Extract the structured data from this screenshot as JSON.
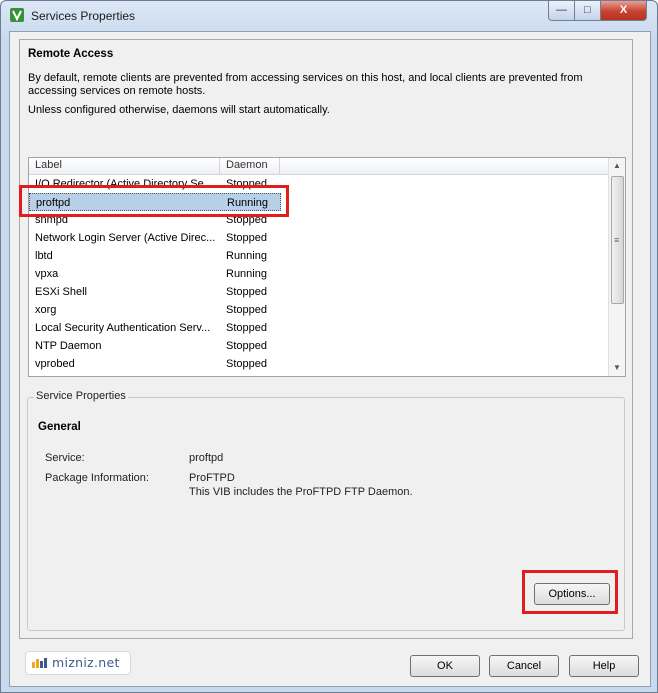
{
  "window": {
    "title": "Services Properties",
    "minimize_glyph": "—",
    "maximize_glyph": "□",
    "close_glyph": "X"
  },
  "header": {
    "title": "Remote Access",
    "description1": "By default, remote clients are prevented from accessing services on this host, and local clients are prevented from accessing services on remote hosts.",
    "description2": "Unless configured otherwise, daemons will start automatically."
  },
  "list": {
    "columns": [
      "Label",
      "Daemon"
    ],
    "rows": [
      {
        "label": "I/O Redirector (Active Directory Se...",
        "daemon": "Stopped"
      },
      {
        "label": "proftpd",
        "daemon": "Running"
      },
      {
        "label": "snmpd",
        "daemon": "Stopped"
      },
      {
        "label": "Network Login Server (Active Direc...",
        "daemon": "Stopped"
      },
      {
        "label": "lbtd",
        "daemon": "Running"
      },
      {
        "label": "vpxa",
        "daemon": "Running"
      },
      {
        "label": "ESXi Shell",
        "daemon": "Stopped"
      },
      {
        "label": "xorg",
        "daemon": "Stopped"
      },
      {
        "label": "Local Security Authentication Serv...",
        "daemon": "Stopped"
      },
      {
        "label": "NTP Daemon",
        "daemon": "Stopped"
      },
      {
        "label": "vprobed",
        "daemon": "Stopped"
      }
    ],
    "selected_index": 1
  },
  "service_properties": {
    "legend": "Service Properties",
    "section": "General",
    "service_label": "Service:",
    "service_value": "proftpd",
    "package_label": "Package Information:",
    "package_line1": "ProFTPD",
    "package_line2": "This VIB includes the ProFTPD FTP Daemon.",
    "options_button": "Options..."
  },
  "footer": {
    "logo_text": "mizniz.net",
    "ok_button": "OK",
    "cancel_button": "Cancel",
    "help_button": "Help"
  },
  "colors": {
    "highlight": "#e01e1e",
    "selection": "#b8cfe8"
  }
}
